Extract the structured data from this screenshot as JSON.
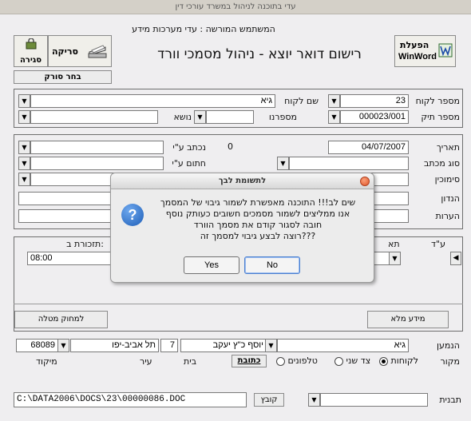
{
  "window": {
    "title": "עדי בתוכנה לניהול במשרד עורכי דין",
    "licensed_user": "המשתמש המורשה : עדי מערכות מידע",
    "main_title": "רישום דואר יוצא - ניהול מסמכי וורד"
  },
  "toolbar": {
    "winword_line1": "הפעלת",
    "winword_line2": "WinWord",
    "scan_label": "סריקה",
    "close_label": "סגירה",
    "choose_scanner_label": "בחר סורק"
  },
  "client": {
    "client_number_label": "מספר לקוח",
    "client_number_value": "23",
    "client_name_label": "שם לקוח",
    "client_name_value": "גיא",
    "file_number_label": "מספר תיק",
    "file_number_value": "000023/001",
    "serial_label": "מספרנו",
    "serial_value": "",
    "subject_label": "נושא",
    "subject_value": ""
  },
  "letter": {
    "date_label": "תאריך",
    "date_value": "04/07/2007",
    "written_by_label": "נכתב ע\"י",
    "written_by_value": "0",
    "letter_type_label": "סוג מכתב",
    "signed_by_label": "חתום ע\"י",
    "reference_label": "סימוכין",
    "subject_label": "הנדון",
    "notes_label": "הערות"
  },
  "tasks": {
    "col_id_label": "ע\"ד",
    "col_date_label": "תא",
    "col_reminder_label": "תזכורת ב:",
    "row_time": "08:00",
    "delete_task_label": "למחוק מטלה",
    "full_info_label": "מידע מלא"
  },
  "recipient": {
    "recipient_label": "הנמען",
    "recipient_value": "גיא",
    "contact_value": "יוסף כ\"ץ יעקב",
    "house_value": "7",
    "city_value": "תל אביב-יפו",
    "zip_value": "68089",
    "source_label": "מקור",
    "radio_clients": "לקוחות",
    "radio_third_party": "צד שני",
    "radio_phones": "טלפונים",
    "address_button": "כתובת",
    "house_label": "בית",
    "city_label": "עיר",
    "zip_label": "מיקוד"
  },
  "footer": {
    "template_label": "תבנית",
    "file_button": "קובץ",
    "file_path": "C:\\DATA2006\\DOCS\\23\\00000086.DOC"
  },
  "dialog": {
    "title": "לתשומת לבך",
    "line1": "שים לב!!! התוכנה מאפשרת לשמור גיבוי של המסמך",
    "line2": "אנו ממליצים לשמור מסמכים חשובים כעותק נוסף",
    "line3": "חובה לסגור קודם את מסמך הוורד",
    "line4": "רוצה לבצע גיבוי למסמך זה???",
    "yes_label": "Yes",
    "no_label": "No"
  },
  "colors": {
    "background": "#efeef0",
    "title_bar": "#d4d0c8",
    "dialog_close": "#ea6a3a",
    "question_icon": "#1f5fb8"
  }
}
